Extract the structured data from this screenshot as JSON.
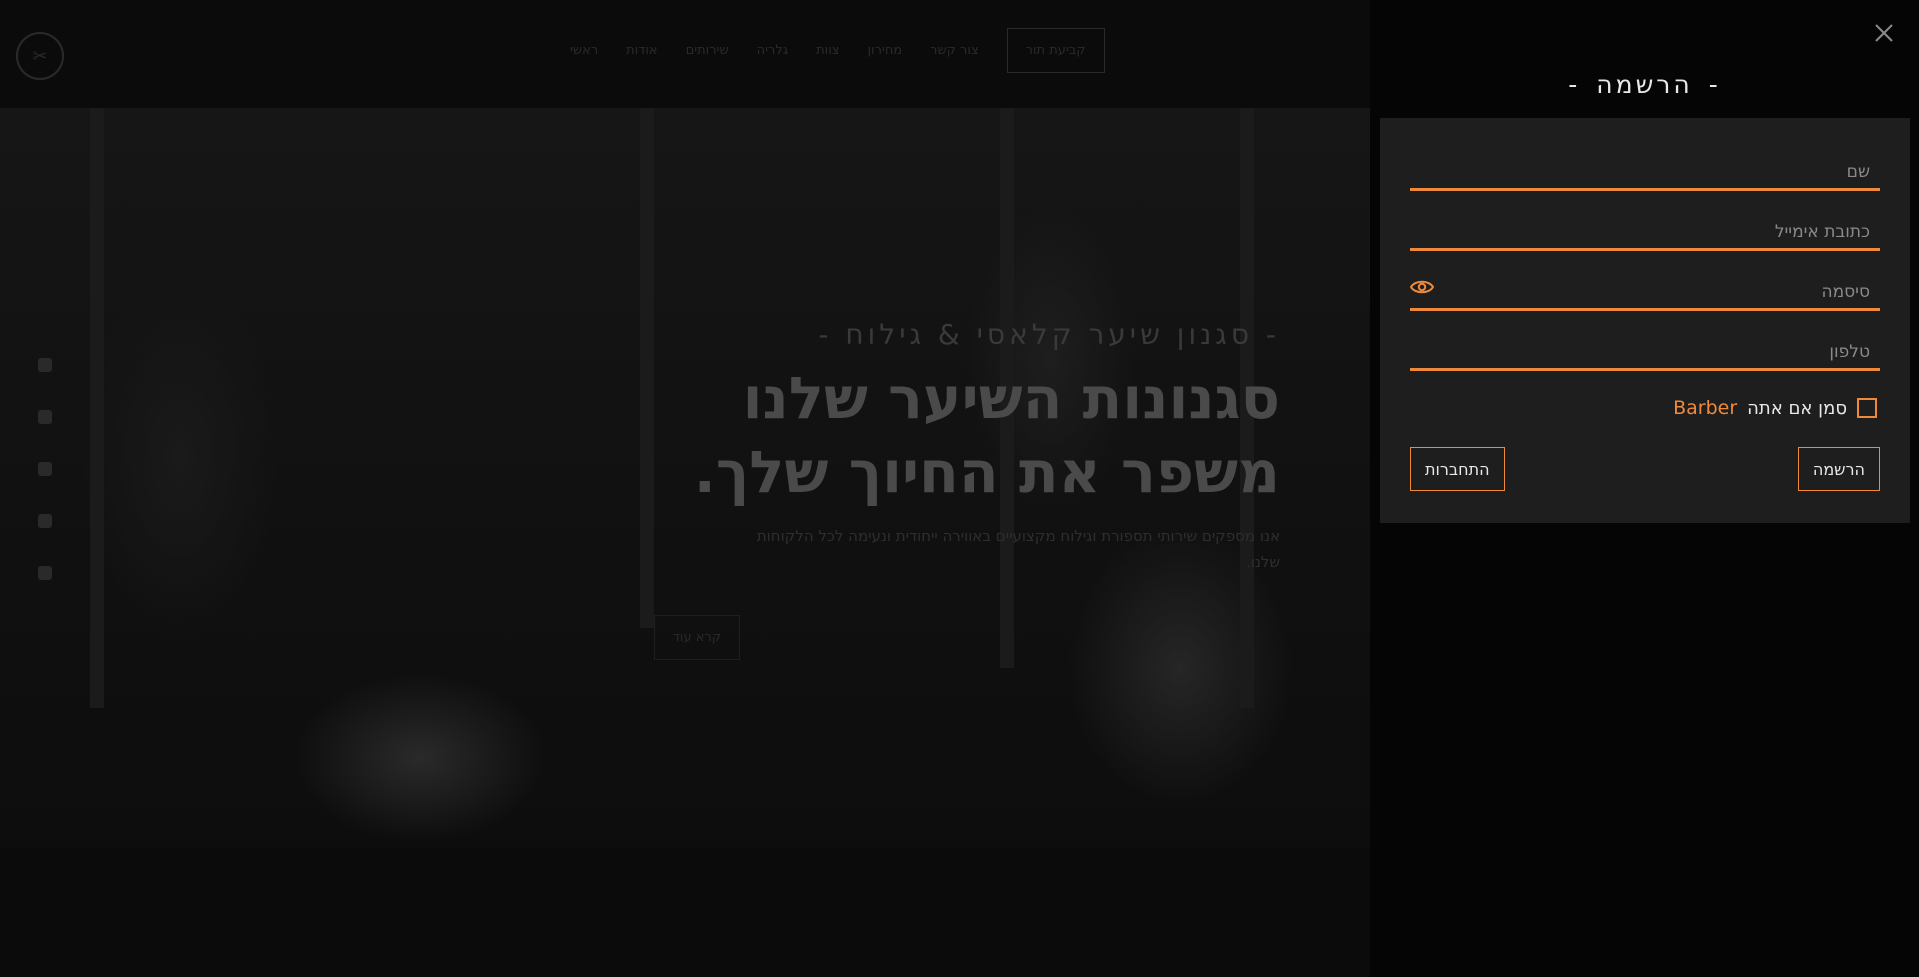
{
  "background": {
    "nav": {
      "items": [
        "ראשי",
        "אודות",
        "שירותים",
        "גלריה",
        "צוות",
        "מחירון",
        "צור קשר"
      ],
      "cta_label": "קביעת תור"
    },
    "hero": {
      "tagline": "- סגנון שיער קלאסי & גילוח -",
      "title_line1": "סגנונות השיער שלנו",
      "title_line2": "משפר את החיוך שלך.",
      "description": "אנו מספקים שירותי תספורת וגילוח מקצועיים באווירה ייחודית ונעימה לכל הלקוחות שלנו.",
      "button_label": "קרא עוד"
    }
  },
  "modal": {
    "heading": "הרשמה",
    "fields": {
      "name_placeholder": "שם",
      "email_placeholder": "כתובת אימייל",
      "password_placeholder": "סיסמה",
      "phone_placeholder": "טלפון"
    },
    "checkbox": {
      "label": "סמן אם אתה",
      "brand": "Barber",
      "checked": false
    },
    "buttons": {
      "register_label": "הרשמה",
      "login_label": "התחברות"
    }
  },
  "colors": {
    "accent": "#ef8a3c",
    "panel": "#1e1e1e",
    "overlay": "#050505",
    "text": "#e8e8e8"
  },
  "icons": {
    "close": "close-icon",
    "password_toggle": "eye-icon"
  }
}
